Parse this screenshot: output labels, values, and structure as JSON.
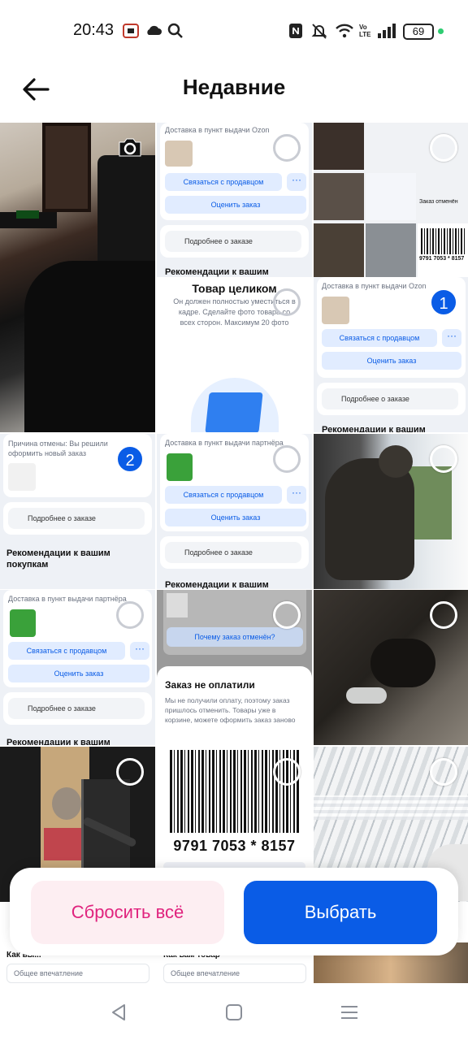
{
  "status": {
    "time": "20:43",
    "battery": "69",
    "network_label": "Vo LTE"
  },
  "header": {
    "title": "Недавние"
  },
  "tiles": {
    "t2": {
      "delivery": "Доставка в пункт выдачи Ozon",
      "contact": "Связаться с продавцом",
      "rate": "Оценить заказ",
      "details": "Подробнее о заказе",
      "reco": "Рекомендации к вашим"
    },
    "t3": {
      "ship": "Заказ отменён",
      "barcode": "9791 7053 * 8157"
    },
    "t5": {
      "title": "Товар целиком",
      "text": "Он должен полностью уместиться в кадре. Сделайте фото товара со всех сторон. Максимум 20 фото"
    },
    "t6": {
      "delivery": "Доставка в пункт выдачи Ozon",
      "contact": "Связаться с продавцом",
      "rate": "Оценить заказ",
      "details": "Подробнее о заказе",
      "reco": "Рекомендации к вашим",
      "badge": "1"
    },
    "t7": {
      "reason": "Причина отмены: Вы решили оформить новый заказ",
      "details": "Подробнее о заказе",
      "reco": "Рекомендации к вашим покупкам",
      "badge": "2"
    },
    "t8": {
      "delivery": "Доставка в пункт выдачи партнёра",
      "contact": "Связаться с продавцом",
      "rate": "Оценить заказ",
      "details": "Подробнее о заказе",
      "reco": "Рекомендации к вашим"
    },
    "t10": {
      "delivery": "Доставка в пункт выдачи партнёра",
      "contact": "Связаться с продавцом",
      "rate": "Оценить заказ",
      "details": "Подробнее о заказе",
      "reco": "Рекомендации к вашим"
    },
    "t11": {
      "why": "Почему заказ отменён?",
      "title": "Заказ не оплатили",
      "text": "Мы не получили оплату, поэтому заказ пришлось отменить. Товары уже в корзине, можете оформить заказ заново"
    },
    "t14": {
      "barcode": "9791 7053 * 8157"
    }
  },
  "peek": {
    "left_label": "Как вы...",
    "left_field": "Общее впечатление",
    "mid_label": "Как вам товар",
    "mid_field": "Общее впечатление"
  },
  "actions": {
    "reset": "Сбросить всё",
    "choose": "Выбрать"
  },
  "colors": {
    "accent": "#0a5ce6",
    "reset_text": "#e0237e",
    "reset_bg": "#fdeef2"
  },
  "icons": {
    "back": "arrow-left-icon",
    "camera": "camera-icon",
    "nav_back": "triangle-back-icon",
    "nav_home": "square-home-icon",
    "nav_menu": "menu-lines-icon"
  }
}
